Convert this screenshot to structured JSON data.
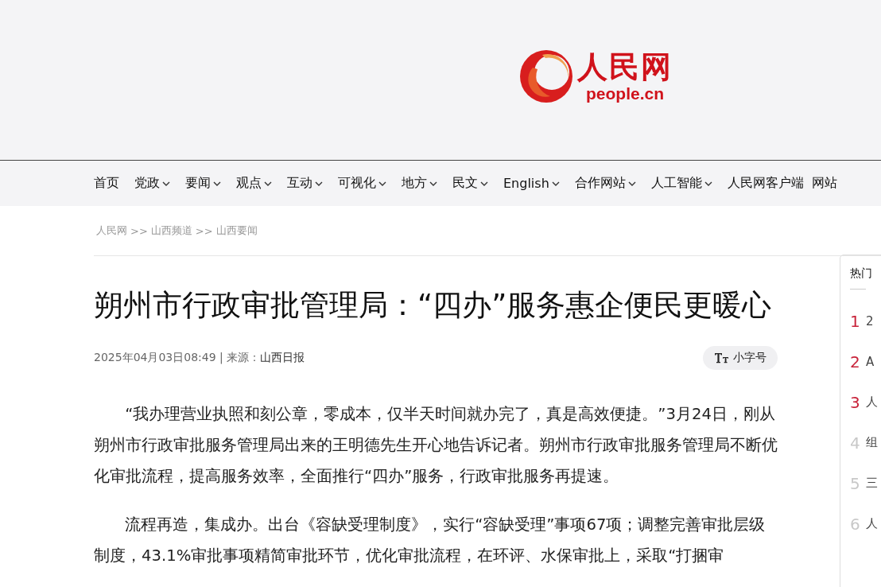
{
  "logo": {
    "name": "人民网",
    "domain": "people.cn"
  },
  "nav": [
    {
      "label": "首页",
      "dropdown": false
    },
    {
      "label": "党政",
      "dropdown": true
    },
    {
      "label": "要闻",
      "dropdown": true
    },
    {
      "label": "观点",
      "dropdown": true
    },
    {
      "label": "互动",
      "dropdown": true
    },
    {
      "label": "可视化",
      "dropdown": true
    },
    {
      "label": "地方",
      "dropdown": true
    },
    {
      "label": "民文",
      "dropdown": true
    },
    {
      "label": "English",
      "dropdown": true
    },
    {
      "label": "合作网站",
      "dropdown": true
    },
    {
      "label": "人工智能",
      "dropdown": true
    },
    {
      "label": "人民网客户端",
      "dropdown": false
    },
    {
      "label": "网站",
      "dropdown": false
    }
  ],
  "breadcrumb": [
    "人民网",
    "山西频道",
    "山西要闻"
  ],
  "breadcrumb_separator": ">>",
  "article": {
    "title": "朔州市行政审批管理局：“四办”服务惠企便民更暖心",
    "meta": "2025年04月03日08:49 | 来源：",
    "source": "山西日报",
    "font_button": "小字号",
    "paragraphs": [
      "“我办理营业执照和刻公章，零成本，仅半天时间就办完了，真是高效便捷。”3月24日，刚从朔州市行政审批服务管理局出来的王明德先生开心地告诉记者。朔州市行政审批服务管理局不断优化审批流程，提高服务效率，全面推行“四办”服务，行政审批服务再提速。",
      "流程再造，集成办。出台《容缺受理制度》，实行“容缺受理”事项67项；调整完善审批层级制度，43.1%审批事项精简审批环节，优化审批流程，在环评、水保审批上，采取“打捆审"
    ]
  },
  "hot_list": {
    "title": "热门",
    "items": [
      {
        "rank": "1",
        "text": "2",
        "color": "#c8233a"
      },
      {
        "rank": "2",
        "text": "A",
        "color": "#c8233a"
      },
      {
        "rank": "3",
        "text": "人",
        "color": "#c8233a"
      },
      {
        "rank": "4",
        "text": "组",
        "color": "#c8c8c8"
      },
      {
        "rank": "5",
        "text": "三",
        "color": "#c8c8c8"
      },
      {
        "rank": "6",
        "text": "人",
        "color": "#c8c8c8"
      }
    ]
  }
}
